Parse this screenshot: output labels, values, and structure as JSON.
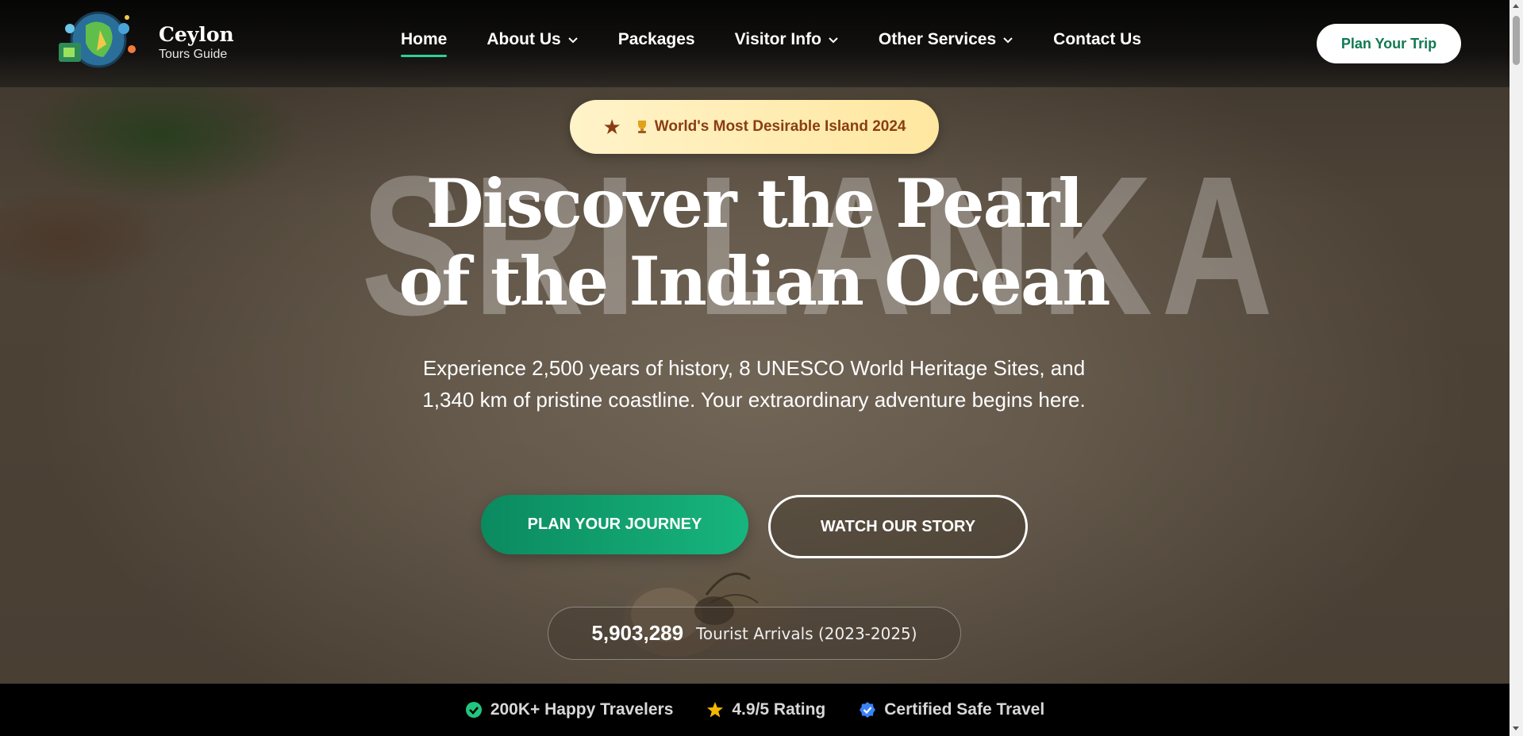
{
  "header": {
    "brand_name": "Ceylon",
    "brand_sub": "Tours Guide",
    "nav": [
      {
        "label": "Home",
        "active": true,
        "dropdown": false
      },
      {
        "label": "About Us",
        "active": false,
        "dropdown": true
      },
      {
        "label": "Packages",
        "active": false,
        "dropdown": false
      },
      {
        "label": "Visitor Info",
        "active": false,
        "dropdown": true
      },
      {
        "label": "Other Services",
        "active": false,
        "dropdown": true
      },
      {
        "label": "Contact Us",
        "active": false,
        "dropdown": false
      }
    ],
    "cta_label": "Plan Your Trip"
  },
  "hero": {
    "badge_icon": "star-icon",
    "badge_text": "World's Most Desirable Island 2024",
    "watermark": "SRI LANKA",
    "headline_line1": "Discover the Pearl",
    "headline_line2": "of the Indian Ocean",
    "subtext": "Experience 2,500 years of history, 8 UNESCO World Heritage Sites, and 1,340 km of pristine coastline. Your extraordinary adventure begins here.",
    "primary_button": "PLAN YOUR JOURNEY",
    "secondary_button": "WATCH OUR STORY",
    "stat_number": "5,903,289",
    "stat_label": "Tourist Arrivals (2023-2025)"
  },
  "trust_bar": [
    {
      "icon": "check-circle-icon",
      "color": "#22c57f",
      "text": "200K+ Happy Travelers"
    },
    {
      "icon": "star-icon",
      "color": "#f5b800",
      "text": "4.9/5 Rating"
    },
    {
      "icon": "verified-badge-icon",
      "color": "#3b82f6",
      "text": "Certified Safe Travel"
    }
  ],
  "colors": {
    "accent_green": "#17b57e",
    "badge_text": "#8a3d12",
    "cta_text": "#0f7a4f"
  }
}
